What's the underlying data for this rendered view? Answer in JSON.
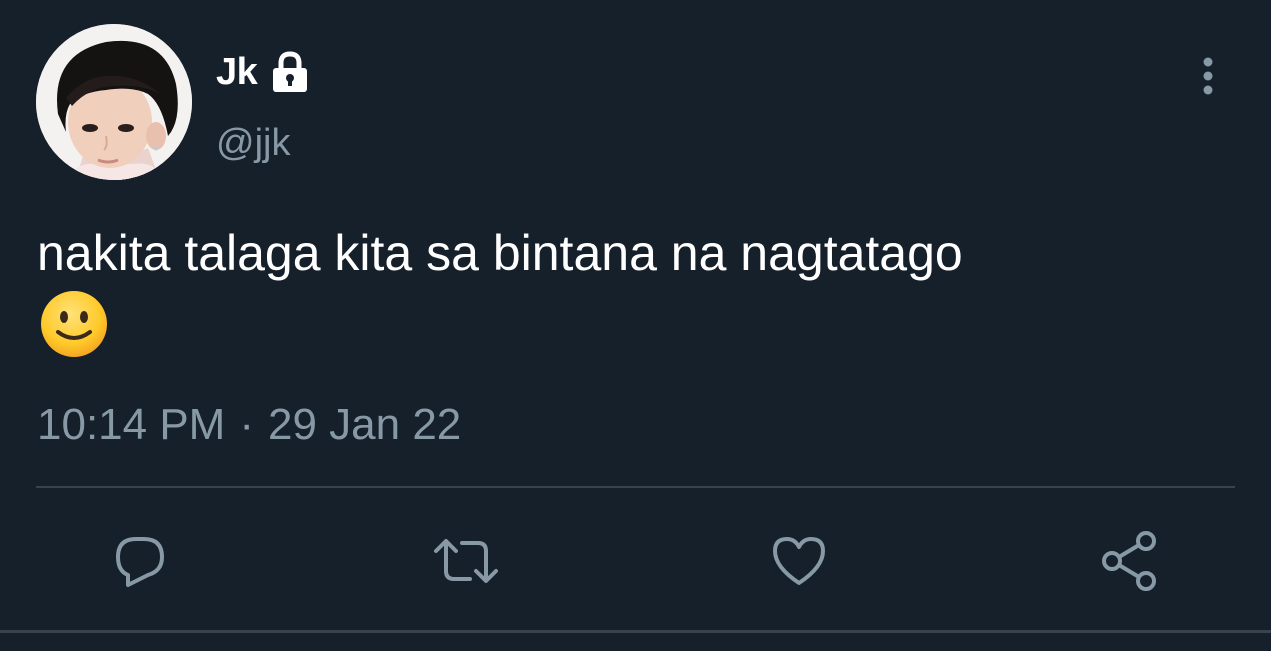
{
  "user": {
    "display_name": "Jk",
    "handle": "@jjk",
    "protected_icon": "lock-icon",
    "avatar": "profile-photo"
  },
  "tweet": {
    "text": "nakita talaga kita sa bintana na nagtatago",
    "emoji": "slightly-smiling-face-emoji",
    "time": "10:14 PM",
    "separator": "·",
    "date": "29 Jan 22"
  },
  "actions": [
    {
      "name": "reply",
      "icon": "reply-icon"
    },
    {
      "name": "retweet",
      "icon": "retweet-icon"
    },
    {
      "name": "like",
      "icon": "heart-icon"
    },
    {
      "name": "share",
      "icon": "share-icon"
    }
  ],
  "colors": {
    "background": "#15202b",
    "primary_text": "#ffffff",
    "secondary_text": "#8899a6",
    "divider": "#38444d"
  }
}
